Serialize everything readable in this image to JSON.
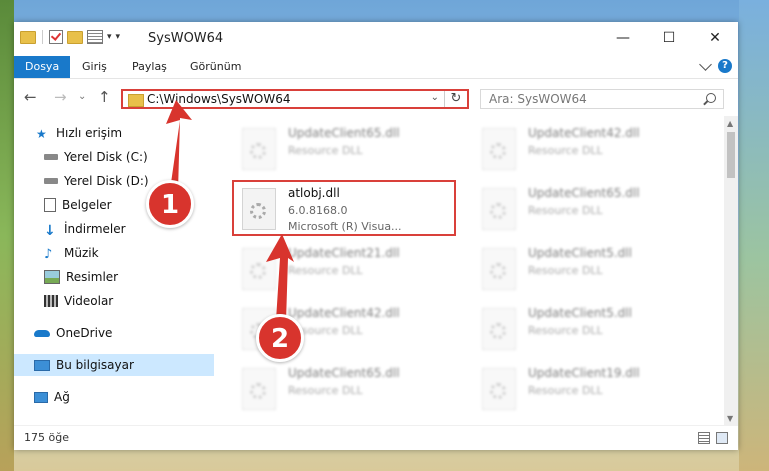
{
  "window": {
    "title": "SysWOW64",
    "controls": {
      "minimize": "—",
      "maximize": "☐",
      "close": "✕"
    }
  },
  "ribbon": {
    "tabs": [
      "Dosya",
      "Giriş",
      "Paylaş",
      "Görünüm"
    ],
    "help": "?"
  },
  "address": {
    "path": "C:\\Windows\\SysWOW64",
    "dropdown": "⌄",
    "refresh": "↻"
  },
  "search": {
    "placeholder": "Ara: SysWOW64"
  },
  "nav_buttons": {
    "back": "←",
    "forward": "→",
    "expand": "⌄",
    "up": "↑"
  },
  "navpane": {
    "quick_access": "Hızlı erişim",
    "items": [
      {
        "label": "Yerel Disk (C:)",
        "icon": "drive-icon"
      },
      {
        "label": "Yerel Disk (D:)",
        "icon": "drive-icon"
      },
      {
        "label": "Belgeler",
        "icon": "documents-icon"
      },
      {
        "label": "İndirmeler",
        "icon": "download-icon"
      },
      {
        "label": "Müzik",
        "icon": "music-icon"
      },
      {
        "label": "Resimler",
        "icon": "pictures-icon"
      },
      {
        "label": "Videolar",
        "icon": "video-icon"
      }
    ],
    "onedrive": "OneDrive",
    "this_pc": "Bu bilgisayar",
    "network": "Ağ",
    "pin": "📌"
  },
  "files": {
    "left": [
      {
        "name": "UpdateClient65.dll",
        "type": "Resource DLL"
      },
      {
        "name": "atlobj.dll",
        "version": "6.0.8168.0",
        "desc": "Microsoft (R) Visua...",
        "highlighted": true
      },
      {
        "name": "UpdateClient21.dll",
        "type": "Resource DLL"
      },
      {
        "name": "UpdateClient42.dll",
        "type": "Resource DLL"
      },
      {
        "name": "UpdateClient65.dll",
        "type": "Resource DLL"
      }
    ],
    "right": [
      {
        "name": "UpdateClient42.dll",
        "type": "Resource DLL"
      },
      {
        "name": "UpdateClient65.dll",
        "type": "Resource DLL"
      },
      {
        "name": "UpdateClient5.dll",
        "type": "Resource DLL"
      },
      {
        "name": "UpdateClient5.dll",
        "type": "Resource DLL"
      },
      {
        "name": "UpdateClient19.dll",
        "type": "Resource DLL"
      }
    ]
  },
  "status": {
    "count": "175 öğe"
  },
  "callouts": [
    "1",
    "2"
  ],
  "colors": {
    "accent": "#1979ca",
    "highlight": "#d9403a",
    "selected": "#cce8ff"
  }
}
